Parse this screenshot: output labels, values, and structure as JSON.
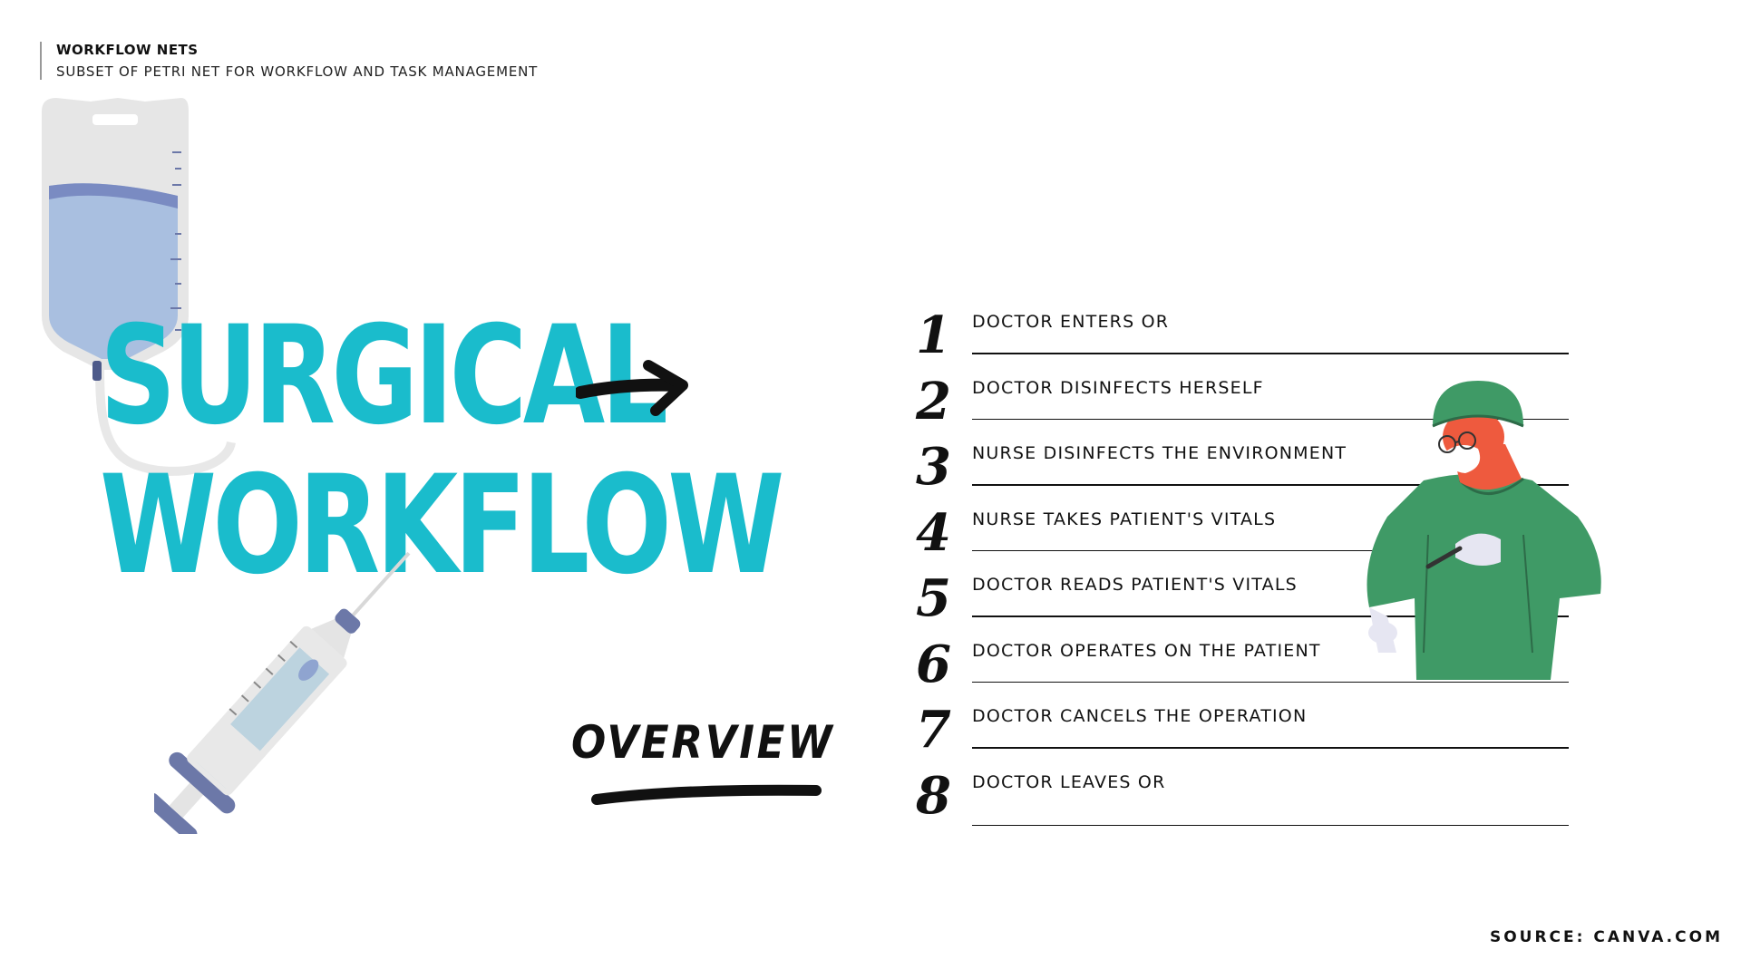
{
  "header": {
    "title": "WORKFLOW NETS",
    "subtitle": "SUBSET OF PETRI NET FOR WORKFLOW AND TASK MANAGEMENT"
  },
  "title": {
    "line1": "SURGICAL",
    "line2": "WORKFLOW"
  },
  "overview_label": "OVERVIEW",
  "steps": [
    {
      "number": "1",
      "text": "DOCTOR ENTERS OR"
    },
    {
      "number": "2",
      "text": "DOCTOR DISINFECTS HERSELF"
    },
    {
      "number": "3",
      "text": "NURSE DISINFECTS THE ENVIRONMENT"
    },
    {
      "number": "4",
      "text": "NURSE TAKES PATIENT'S VITALS"
    },
    {
      "number": "5",
      "text": "DOCTOR READS PATIENT'S VITALS"
    },
    {
      "number": "6",
      "text": "DOCTOR OPERATES ON THE PATIENT"
    },
    {
      "number": "7",
      "text": "DOCTOR CANCELS THE OPERATION"
    },
    {
      "number": "8",
      "text": "DOCTOR LEAVES OR"
    }
  ],
  "source": "SOURCE: CANVA.COM",
  "colors": {
    "title": "#1abccc",
    "scrubs": "#3f9a66",
    "skin": "#ee5a3e",
    "iv_fluid": "#a9bfe0",
    "syringe_accent": "#6c78a8"
  },
  "icons": {
    "iv_bag": "iv-bag-icon",
    "syringe": "syringe-icon",
    "arrow": "arrow-icon",
    "surgeon": "surgeon-illustration"
  }
}
